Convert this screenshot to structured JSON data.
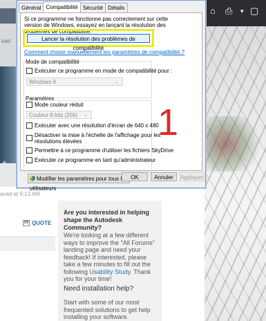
{
  "dialog": {
    "tabs": [
      "Général",
      "Compatibilité",
      "Sécurité",
      "Détails"
    ],
    "intro": "Si ce programme ne fonctionne pas correctement sur cette version de Windows, essayez en lançant la résolution des problèmes de compatibilité.",
    "launch_button": "Lancer la résolution des problèmes de compatibilité",
    "manual_link": "Comment choisir manuellement les paramètres de compatibilité ?",
    "compat_mode": {
      "label": "Mode de compatibilité",
      "checkbox": "Exécuter ce programme en mode de compatibilité pour :",
      "select": "Windows 8"
    },
    "params": {
      "label": "Paramètres",
      "reduced_color": "Mode couleur réduit",
      "color_select": "Couleur 8 bits (256)",
      "res640": "Exécuter avec une résolution d'écran de 640 x 480",
      "dpi_line1": "Désactiver la mise à l'échelle de l'affichage pour les",
      "dpi_line2": "résolutions élevées",
      "skydrive": "Permettre à ce programme d'utiliser les fichiers SkyDrive",
      "admin": "Exécuter ce programme en tant qu'administrateur"
    },
    "modify_button": "Modifier les paramètres pour tous les utilisateurs",
    "ok": "OK",
    "cancel": "Annuler",
    "apply": "Appliquer"
  },
  "annotation_number": "1",
  "background": {
    "saved_text": "aved at 6:13 AM",
    "quote": "QUOTE",
    "left_kad": "kad",
    "left_e": "e",
    "panel": {
      "heading": "Are you interested in helping shape the Autodesk Community?",
      "body": "We're looking at a few different ways to improve the \"All Forums\" landing page and need your feedback! If interested, please take a few minutes to fill out the following",
      "link": "Usability Study",
      "tail": ". Thank you for your time!",
      "help_heading": "Need installation help?",
      "help_body": "Start with some of our most frequented solutions to get help installing your software."
    }
  },
  "colors": {
    "highlight": "#f0ea1a",
    "annotation": "#e0282c",
    "link": "#2e6fa8"
  }
}
